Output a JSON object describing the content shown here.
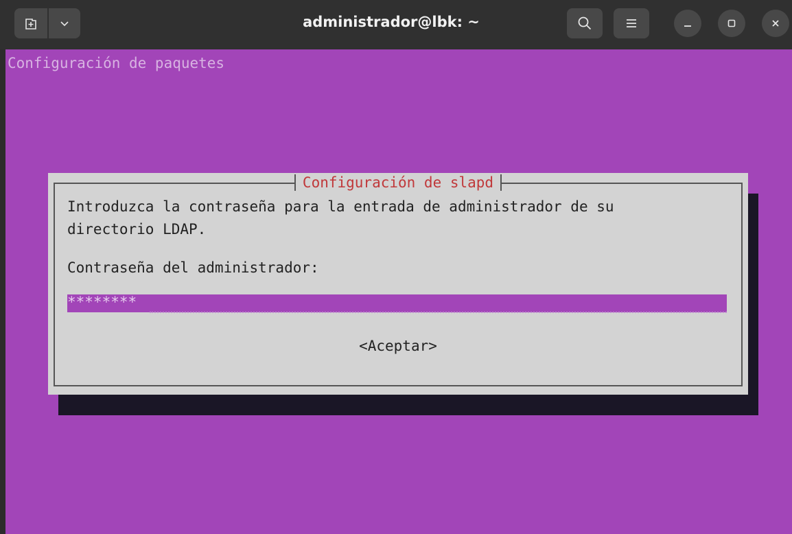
{
  "window": {
    "title": "administrador@lbk: ~",
    "new_tab_icon": "new-tab-icon",
    "menu_dropdown_icon": "chevron-down-icon",
    "search_icon": "search-icon",
    "hamburger_icon": "hamburger-menu-icon",
    "minimize_icon": "minimize-icon",
    "maximize_icon": "maximize-icon",
    "close_icon": "close-icon"
  },
  "terminal": {
    "header": "Configuración de paquetes",
    "colors": {
      "background": "#a245b8",
      "dialog": "#d3d3d3",
      "title": "#c0383a"
    }
  },
  "dialog": {
    "title": "Configuración de slapd",
    "line1": "Introduzca la contraseña para la entrada de administrador de su",
    "line2": "directorio LDAP.",
    "label": "Contraseña del administrador:",
    "password_value": "********",
    "ok_button": "<Aceptar>"
  }
}
